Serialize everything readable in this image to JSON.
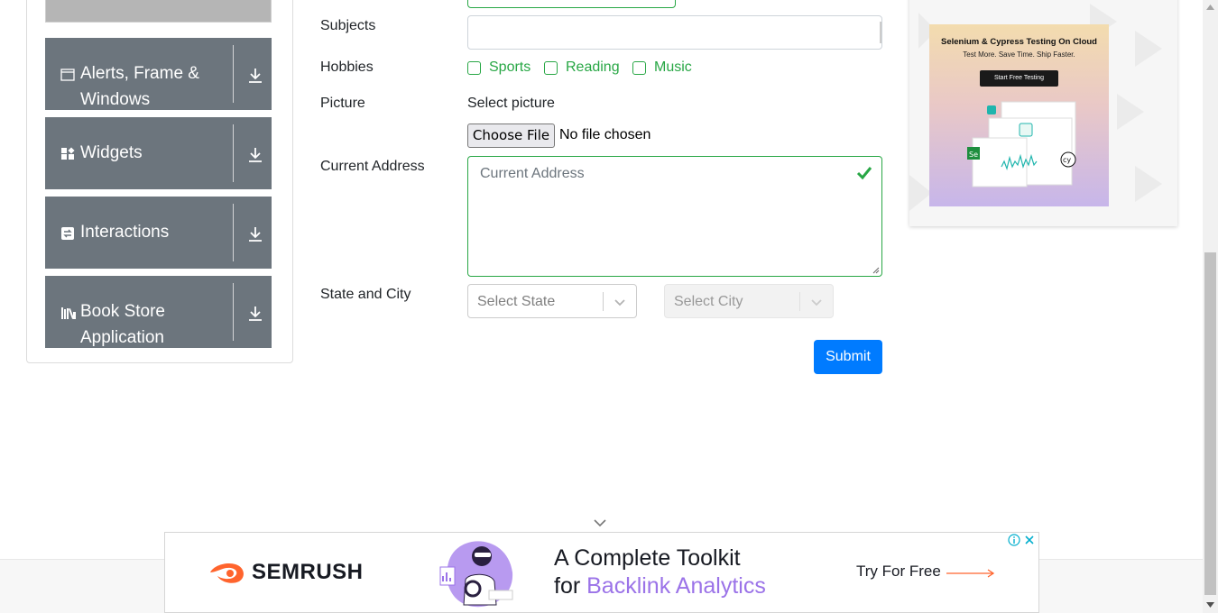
{
  "sidebar": {
    "items": [
      {
        "label_line1": "Alerts, Frame &",
        "label_line2": "Windows",
        "icon": "window-icon"
      },
      {
        "label_line1": "Widgets",
        "icon": "widgets-icon"
      },
      {
        "label_line1": "Interactions",
        "icon": "interactions-icon"
      },
      {
        "label_line1": "Book Store",
        "label_line2": "Application",
        "icon": "bookstore-icon"
      }
    ]
  },
  "form": {
    "subjects_label": "Subjects",
    "hobbies_label": "Hobbies",
    "hobbies": [
      "Sports",
      "Reading",
      "Music"
    ],
    "picture_label": "Picture",
    "picture_prompt": "Select picture",
    "choose_file_label": "Choose File",
    "file_status": "No file chosen",
    "address_label": "Current Address",
    "address_placeholder": "Current Address",
    "state_city_label": "State and City",
    "state_placeholder": "Select State",
    "city_placeholder": "Select City",
    "submit_label": "Submit"
  },
  "ad_right": {
    "headline": "Selenium & Cypress Testing On Cloud",
    "subline": "Test More. Save Time. Ship Faster.",
    "cta": "Start Free Testing"
  },
  "ad_bottom": {
    "brand": "SEMRUSH",
    "line1": "A Complete Toolkit",
    "line2_prefix": "for ",
    "line2_highlight": "Backlink Analytics",
    "cta": "Try For Free"
  },
  "colors": {
    "accent_green": "#28a745",
    "primary_blue": "#007bff",
    "sidebar_gray": "#6c757d",
    "semrush_orange": "#ff642d",
    "highlight_purple": "#9b73e8"
  }
}
